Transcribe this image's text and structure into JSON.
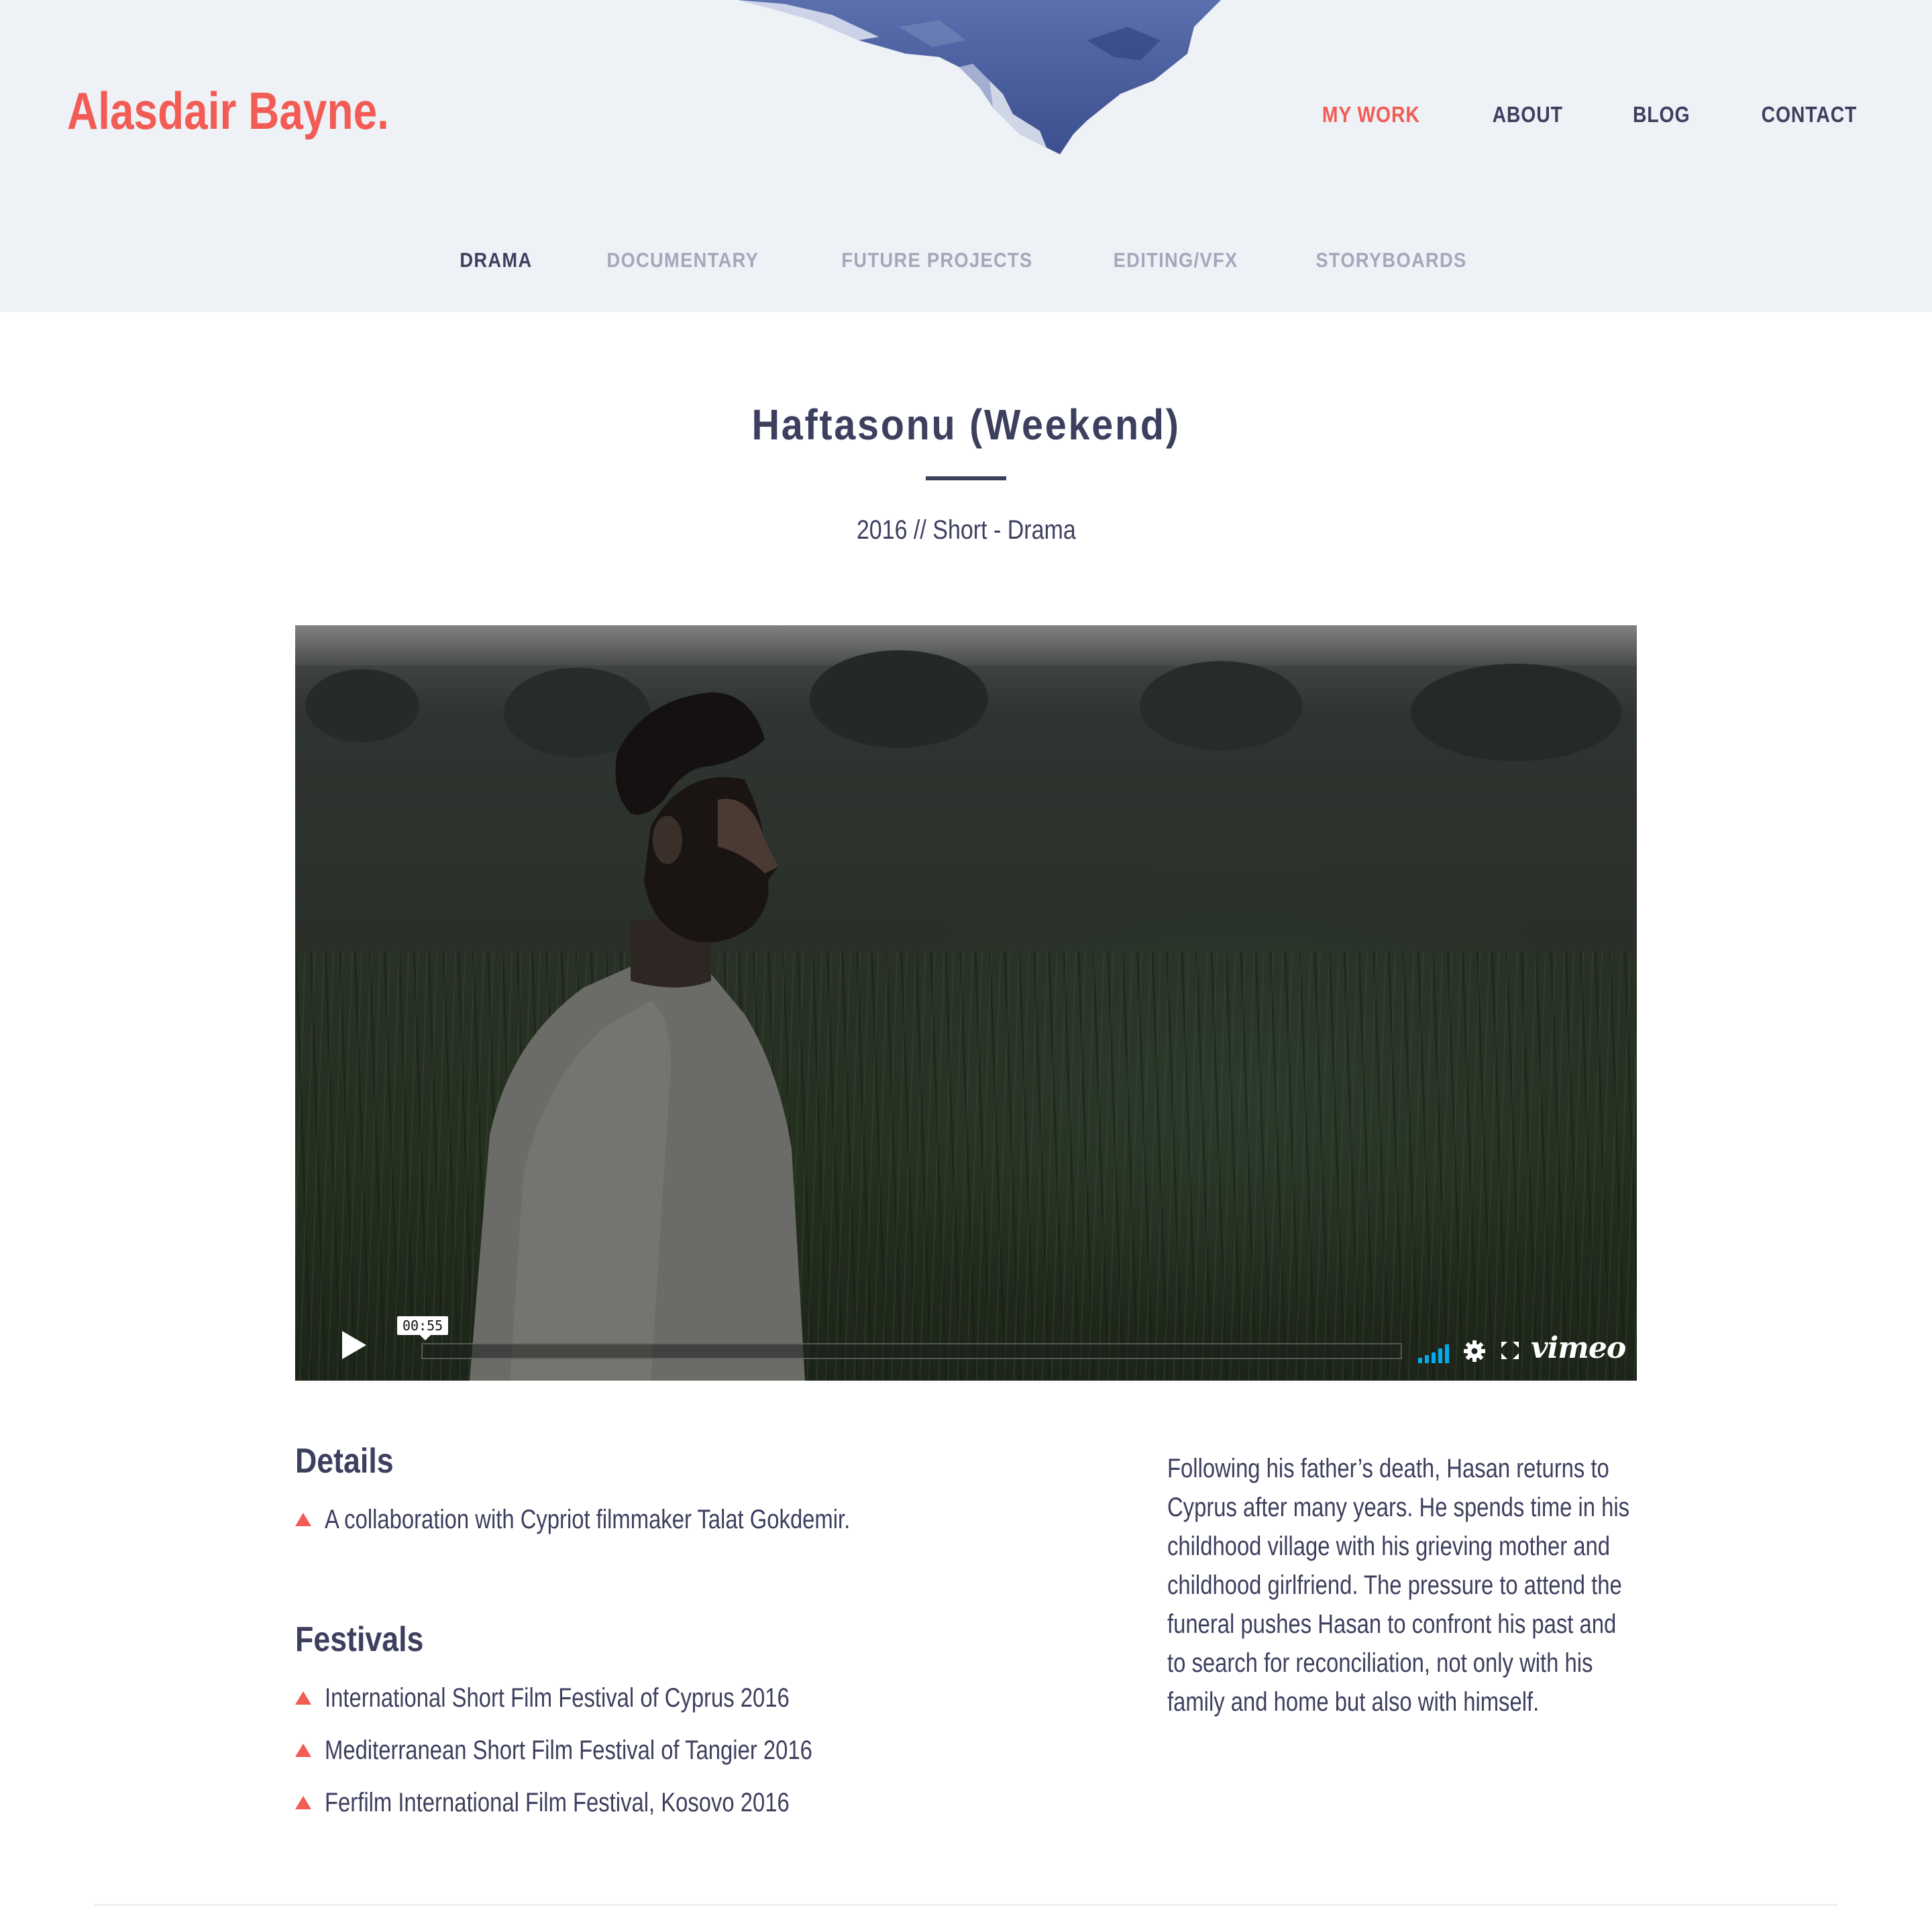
{
  "brand": {
    "logo_text": "Alasdair Bayne.",
    "accent_color": "#f25c54",
    "text_color": "#3d3f5e",
    "header_bg": "#eef1f6"
  },
  "main_nav": [
    {
      "label": "MY WORK",
      "active": true
    },
    {
      "label": "ABOUT",
      "active": false
    },
    {
      "label": "BLOG",
      "active": false
    },
    {
      "label": "CONTACT",
      "active": false
    }
  ],
  "sub_nav": [
    {
      "label": "DRAMA",
      "active": true
    },
    {
      "label": "DOCUMENTARY",
      "active": false
    },
    {
      "label": "FUTURE PROJECTS",
      "active": false
    },
    {
      "label": "EDITING/VFX",
      "active": false
    },
    {
      "label": "STORYBOARDS",
      "active": false
    }
  ],
  "film": {
    "title": "Haftasonu (Weekend)",
    "meta": "2016 // Short - Drama"
  },
  "video": {
    "time_tooltip": "00:55",
    "progress_fraction": 0,
    "brand_label": "vimeo",
    "icons": [
      "play-icon",
      "volume-icon",
      "gear-icon",
      "fullscreen-icon"
    ]
  },
  "details": {
    "heading": "Details",
    "items": [
      "A collaboration with Cypriot filmmaker Talat Gokdemir."
    ]
  },
  "festivals": {
    "heading": "Festivals",
    "items": [
      "International Short Film Festival of Cyprus 2016",
      "Mediterranean Short Film Festival of Tangier 2016",
      "Ferfilm International Film Festival, Kosovo 2016"
    ]
  },
  "synopsis": "Following his father’s death, Hasan returns to Cyprus after many years. He spends time in his childhood village with his grieving mother and childhood girlfriend. The pressure to attend the funeral pushes Hasan to confront his past and to search for reconciliation, not only with his family and home but also with himself."
}
